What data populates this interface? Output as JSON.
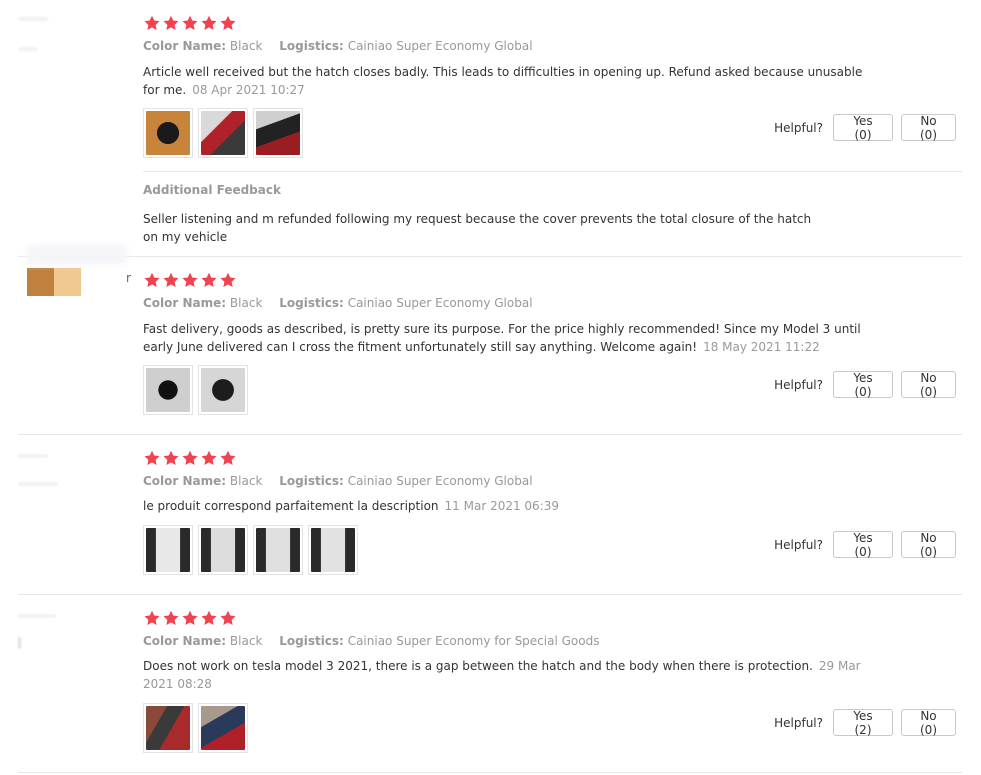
{
  "helpful_label": "Helpful?",
  "accent_star_color": "#e62e04",
  "reviews": [
    {
      "rating": 5,
      "color_key": "Color Name:",
      "color_value": "Black",
      "logistics_key": "Logistics:",
      "logistics_value": "Cainiao Super Economy Global",
      "text": "Article well received but the hatch closes badly. This leads to difficulties in opening up. Refund asked because unusable for me.",
      "date": "08 Apr 2021 10:27",
      "yes": "Yes (0)",
      "no": "No (0)",
      "additional_feedback_title": "Additional Feedback",
      "additional_feedback_text": "Seller listening and m refunded following my request because the cover prevents the total closure of the hatch on my vehicle"
    },
    {
      "rating": 5,
      "user_suffix": "r",
      "color_key": "Color Name:",
      "color_value": "Black",
      "logistics_key": "Logistics:",
      "logistics_value": "Cainiao Super Economy Global",
      "text": "Fast delivery, goods as described, is pretty sure its purpose. For the price highly recommended! Since my Model 3 until early June delivered can I cross the fitment unfortunately still say anything. Welcome again!",
      "date": "18 May 2021 11:22",
      "yes": "Yes (0)",
      "no": "No (0)"
    },
    {
      "rating": 5,
      "color_key": "Color Name:",
      "color_value": "Black",
      "logistics_key": "Logistics:",
      "logistics_value": "Cainiao Super Economy Global",
      "text": "le produit correspond parfaitement la description",
      "date": "11 Mar 2021 06:39",
      "yes": "Yes (0)",
      "no": "No (0)"
    },
    {
      "rating": 5,
      "color_key": "Color Name:",
      "color_value": "Black",
      "logistics_key": "Logistics:",
      "logistics_value": "Cainiao Super Economy for Special Goods",
      "text": "Does not work on tesla model 3 2021, there is a gap between the hatch and the body when there is protection.",
      "date": "29 Mar 2021 08:28",
      "yes": "Yes (2)",
      "no": "No (0)"
    }
  ]
}
